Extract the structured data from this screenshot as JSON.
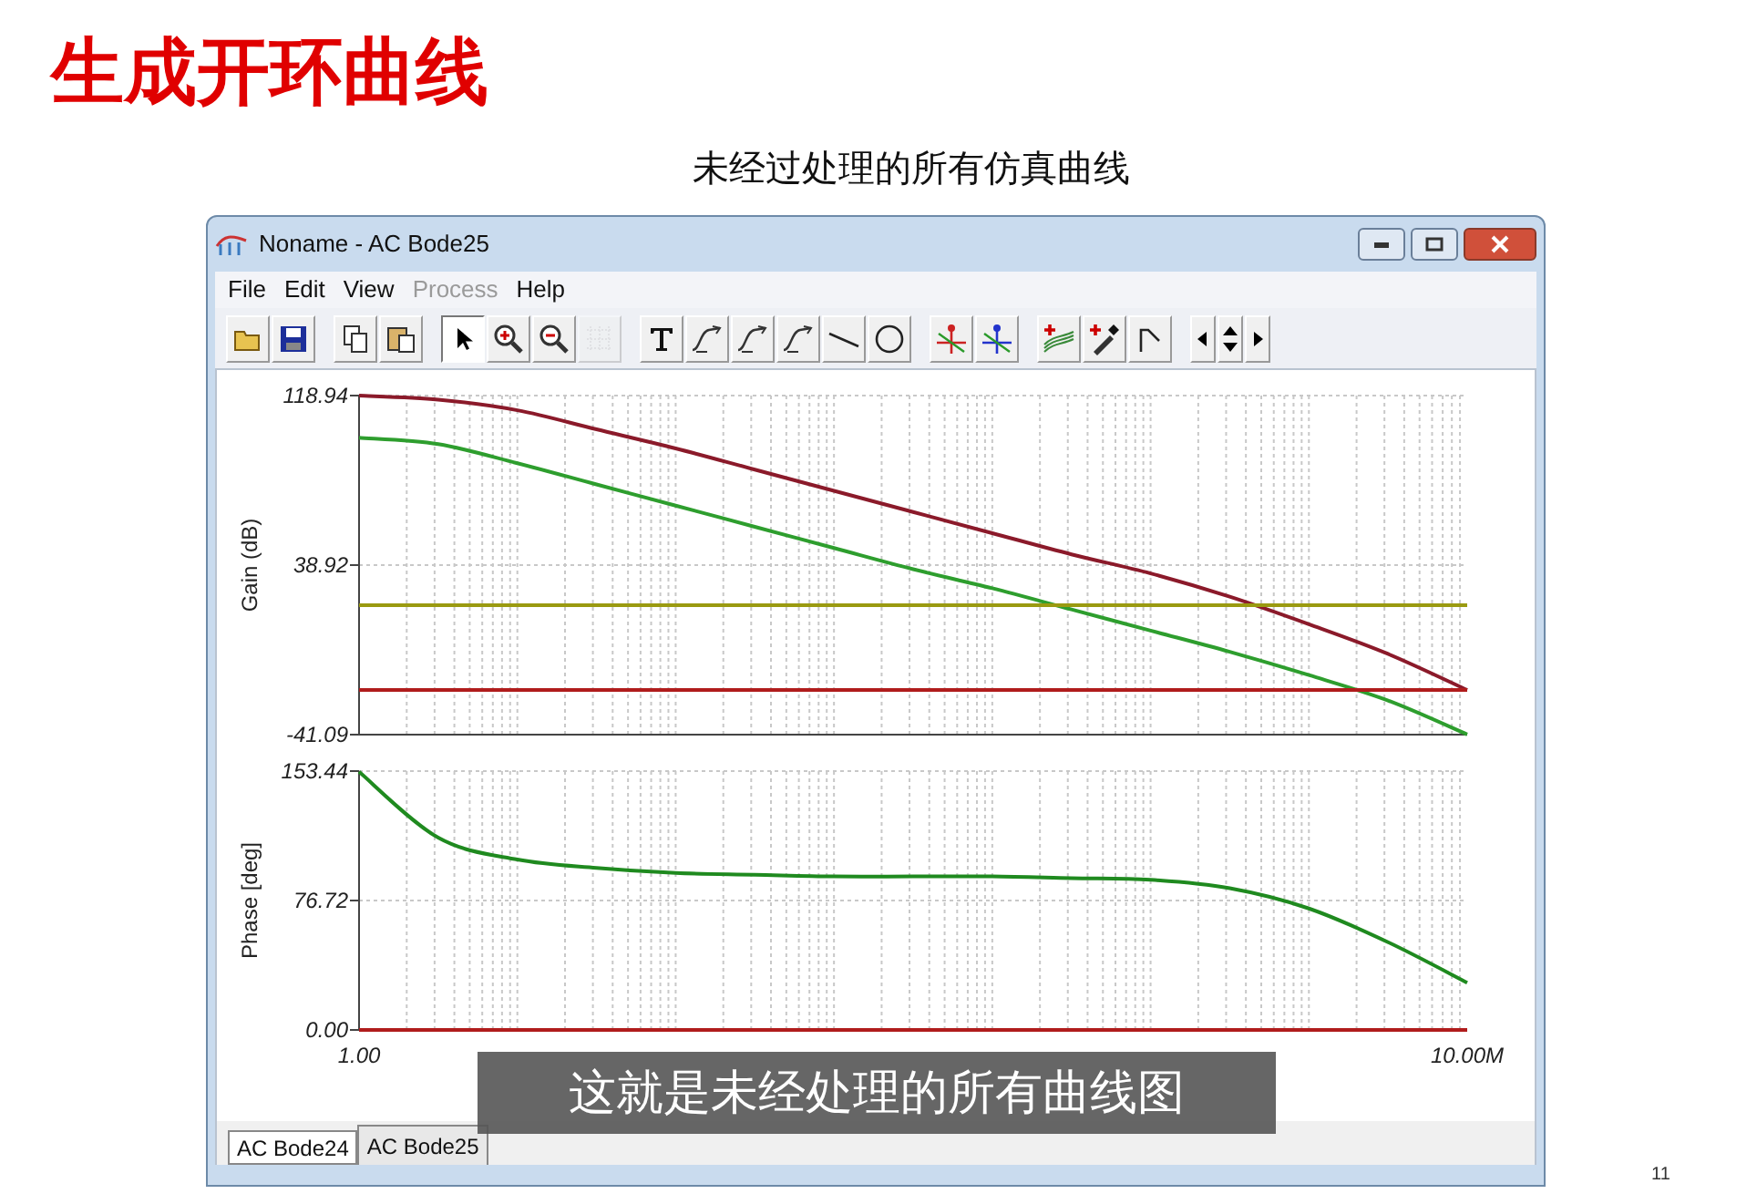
{
  "slide": {
    "title": "生成开环曲线",
    "subtitle": "未经过处理的所有仿真曲线",
    "page_number": "11"
  },
  "window": {
    "title": "Noname - AC Bode25"
  },
  "menu": [
    {
      "label": "File",
      "disabled": false
    },
    {
      "label": "Edit",
      "disabled": false
    },
    {
      "label": "View",
      "disabled": false
    },
    {
      "label": "Process",
      "disabled": true
    },
    {
      "label": "Help",
      "disabled": false
    }
  ],
  "toolbar": [
    {
      "kind": "open",
      "selected": false,
      "disabled": false
    },
    {
      "kind": "save",
      "selected": false,
      "disabled": false
    },
    {
      "kind": "sep"
    },
    {
      "kind": "copy",
      "selected": false,
      "disabled": false
    },
    {
      "kind": "paste",
      "selected": false,
      "disabled": false
    },
    {
      "kind": "sep"
    },
    {
      "kind": "pointer",
      "selected": true,
      "disabled": false
    },
    {
      "kind": "zoomin",
      "selected": false,
      "disabled": false
    },
    {
      "kind": "zoomout",
      "selected": false,
      "disabled": false
    },
    {
      "kind": "grid",
      "selected": false,
      "disabled": true
    },
    {
      "kind": "sep"
    },
    {
      "kind": "text",
      "selected": false,
      "disabled": false
    },
    {
      "kind": "curve",
      "selected": false,
      "disabled": false
    },
    {
      "kind": "curve",
      "selected": false,
      "disabled": false
    },
    {
      "kind": "curve",
      "selected": false,
      "disabled": false
    },
    {
      "kind": "line",
      "selected": false,
      "disabled": false
    },
    {
      "kind": "circle",
      "selected": false,
      "disabled": false
    },
    {
      "kind": "sep"
    },
    {
      "kind": "cursor_a",
      "selected": false,
      "disabled": false
    },
    {
      "kind": "cursor_b",
      "selected": false,
      "disabled": false
    },
    {
      "kind": "sep"
    },
    {
      "kind": "addcurves",
      "selected": false,
      "disabled": false
    },
    {
      "kind": "dropper",
      "selected": false,
      "disabled": false
    },
    {
      "kind": "step",
      "selected": false,
      "disabled": false
    },
    {
      "kind": "sep"
    },
    {
      "kind": "left",
      "selected": false,
      "disabled": false
    },
    {
      "kind": "updown",
      "selected": false,
      "disabled": false
    },
    {
      "kind": "right",
      "selected": false,
      "disabled": false
    }
  ],
  "gain_chart": {
    "chart_data": {
      "type": "line",
      "grid": true,
      "ylabel": "Gain (dB)",
      "categories": [
        null,
        null,
        null,
        null,
        null,
        null,
        null,
        null,
        null,
        null,
        null,
        null,
        null,
        null,
        null
      ],
      "ylim": [
        -41.09,
        118.94
      ],
      "yticks": [
        {
          "value": -41.09,
          "label": "-41.09"
        },
        {
          "value": 38.92,
          "label": "38.92"
        },
        {
          "value": 118.94,
          "label": "118.94"
        }
      ],
      "series": [
        {
          "color": "#8b1a2a",
          "values": [
            118.9,
            117,
            112,
            103,
            94,
            84,
            74,
            64,
            54,
            44,
            35,
            24,
            11,
            -3,
            -20
          ]
        },
        {
          "color": "#2e9e2e",
          "values": [
            99,
            96,
            87,
            77,
            67,
            57,
            47,
            37,
            28,
            18,
            8,
            -2,
            -13,
            -25,
            -41
          ]
        },
        {
          "color": "#9a9a10",
          "values": [
            20,
            20,
            20,
            20,
            20,
            20,
            20,
            20,
            20,
            20,
            20,
            20,
            20,
            20,
            20
          ]
        },
        {
          "color": "#b01c1c",
          "values": [
            -20,
            -20,
            -20,
            -20,
            -20,
            -20,
            -20,
            -20,
            -20,
            -20,
            -20,
            -20,
            -20,
            -20,
            -20
          ]
        }
      ]
    }
  },
  "phase_chart": {
    "chart_data": {
      "type": "line",
      "grid": true,
      "ylabel": "Phase [deg]",
      "categories": [
        "1.00",
        null,
        null,
        null,
        null,
        null,
        null,
        null,
        null,
        null,
        null,
        null,
        null,
        null,
        "10.00M"
      ],
      "ylim": [
        0,
        153.44
      ],
      "yticks": [
        {
          "value": 0,
          "label": "0.00"
        },
        {
          "value": 76.72,
          "label": "76.72"
        },
        {
          "value": 153.44,
          "label": "153.44"
        }
      ],
      "series": [
        {
          "color": "#1f8a1f",
          "values": [
            153,
            114,
            101,
            96,
            93,
            92,
            91,
            91,
            91,
            90,
            89,
            84,
            72,
            52,
            28
          ]
        },
        {
          "color": "#b01c1c",
          "values": [
            0,
            0,
            0,
            0,
            0,
            0,
            0,
            0,
            0,
            0,
            0,
            0,
            0,
            0,
            0
          ]
        }
      ]
    }
  },
  "tabs": [
    {
      "label": "AC Bode24",
      "selected": false
    },
    {
      "label": "AC Bode25",
      "selected": true
    }
  ],
  "caption": "这就是未经处理的所有曲线图"
}
